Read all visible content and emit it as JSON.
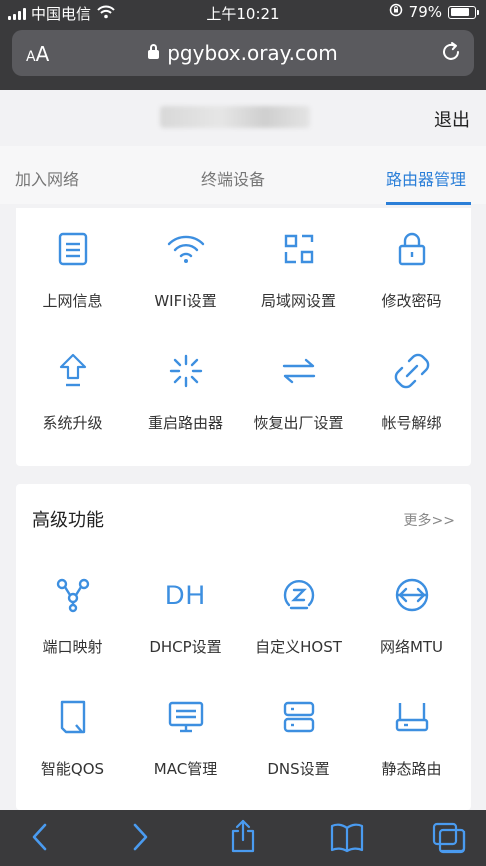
{
  "status": {
    "carrier": "中国电信",
    "time": "上午10:21",
    "battery": "79%",
    "battery_level": 0.79
  },
  "browser": {
    "aa_label": "AA",
    "url": "pgybox.oray.com"
  },
  "header": {
    "logout": "退出"
  },
  "tabs": [
    {
      "label": "加入网络"
    },
    {
      "label": "终端设备"
    },
    {
      "label": "路由器管理"
    }
  ],
  "router_items": [
    {
      "label": "上网信息",
      "icon": "document-icon"
    },
    {
      "label": "WIFI设置",
      "icon": "wifi-icon"
    },
    {
      "label": "局域网设置",
      "icon": "lan-icon"
    },
    {
      "label": "修改密码",
      "icon": "lock-icon"
    },
    {
      "label": "系统升级",
      "icon": "upgrade-arrow-icon"
    },
    {
      "label": "重启路由器",
      "icon": "restart-icon"
    },
    {
      "label": "恢复出厂设置",
      "icon": "reset-arrows-icon"
    },
    {
      "label": "帐号解绑",
      "icon": "unlink-icon"
    }
  ],
  "advanced": {
    "title": "高级功能",
    "more": "更多>>",
    "items": [
      {
        "label": "端口映射",
        "icon": "port-mapping-icon"
      },
      {
        "label": "DHCP设置",
        "icon": "dhcp-icon",
        "glyph": "DH"
      },
      {
        "label": "自定义HOST",
        "icon": "host-icon"
      },
      {
        "label": "网络MTU",
        "icon": "mtu-icon"
      },
      {
        "label": "智能QOS",
        "icon": "qos-icon"
      },
      {
        "label": "MAC管理",
        "icon": "monitor-icon"
      },
      {
        "label": "DNS设置",
        "icon": "server-icon"
      },
      {
        "label": "静态路由",
        "icon": "router-icon"
      }
    ]
  },
  "colors": {
    "accent": "#2b7fd8",
    "icon": "#3d8fe0",
    "chrome": "#3a3a3c"
  }
}
